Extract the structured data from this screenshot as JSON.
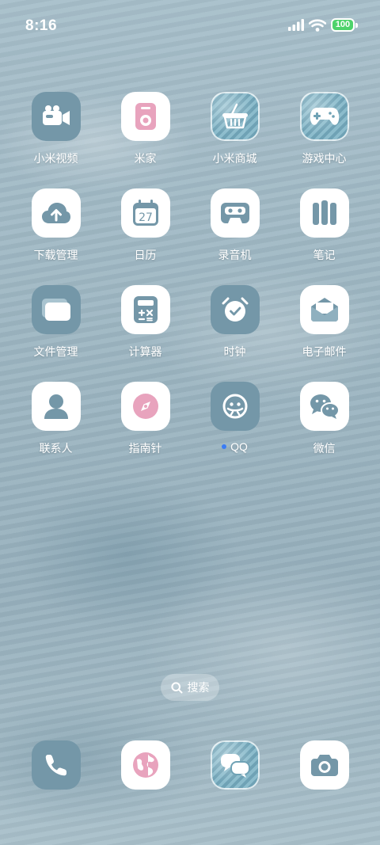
{
  "status_bar": {
    "time": "8:16",
    "battery": "100"
  },
  "apps": [
    {
      "label": "小米视频",
      "icon": "video-camera-icon"
    },
    {
      "label": "米家",
      "icon": "mijia-speaker-icon"
    },
    {
      "label": "小米商城",
      "icon": "shopping-basket-icon"
    },
    {
      "label": "游戏中心",
      "icon": "gamepad-icon"
    },
    {
      "label": "下载管理",
      "icon": "cloud-upload-icon"
    },
    {
      "label": "日历",
      "icon": "calendar-icon",
      "day": "27"
    },
    {
      "label": "录音机",
      "icon": "cassette-icon"
    },
    {
      "label": "笔记",
      "icon": "notes-icon"
    },
    {
      "label": "文件管理",
      "icon": "folder-icon"
    },
    {
      "label": "计算器",
      "icon": "calculator-icon"
    },
    {
      "label": "时钟",
      "icon": "alarm-clock-icon"
    },
    {
      "label": "电子邮件",
      "icon": "envelope-icon"
    },
    {
      "label": "联系人",
      "icon": "person-icon"
    },
    {
      "label": "指南针",
      "icon": "compass-icon"
    },
    {
      "label": "QQ",
      "icon": "qq-penguin-icon",
      "notification_dot": true
    },
    {
      "label": "微信",
      "icon": "wechat-icon"
    }
  ],
  "search": {
    "label": "搜索"
  },
  "dock": [
    {
      "name": "phone",
      "icon": "phone-icon"
    },
    {
      "name": "browser",
      "icon": "globe-icon"
    },
    {
      "name": "messages",
      "icon": "chat-bubbles-icon"
    },
    {
      "name": "camera",
      "icon": "camera-icon"
    }
  ],
  "colors": {
    "icon_blue": "#7497a8",
    "icon_pink": "#e8a3bd",
    "notification_dot": "#3a7cf5",
    "battery_green": "#4ed36b"
  }
}
